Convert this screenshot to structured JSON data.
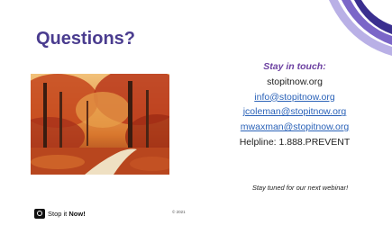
{
  "slide": {
    "title": "Questions?",
    "contact": {
      "heading": "Stay in touch:",
      "website": "stopitnow.org",
      "emails": [
        "info@stopitnow.org",
        "jcoleman@stopitnow.org",
        "mwaxman@stopitnow.org"
      ],
      "helpline": "Helpline: 1.888.PREVENT"
    },
    "tagline": "Stay tuned for our next webinar!",
    "footer": {
      "logo_prefix": "Stop it ",
      "logo_bold": "Now!",
      "copyright": "© 2021"
    },
    "photo": {
      "subject": "autumn forest path"
    }
  },
  "colors": {
    "title": "#4a3c8f",
    "heading": "#6b3fa0",
    "link": "#2a62b8",
    "swoosh_dark": "#3a2f8f",
    "swoosh_mid": "#7b66c8",
    "swoosh_light": "#b9b0e6"
  }
}
